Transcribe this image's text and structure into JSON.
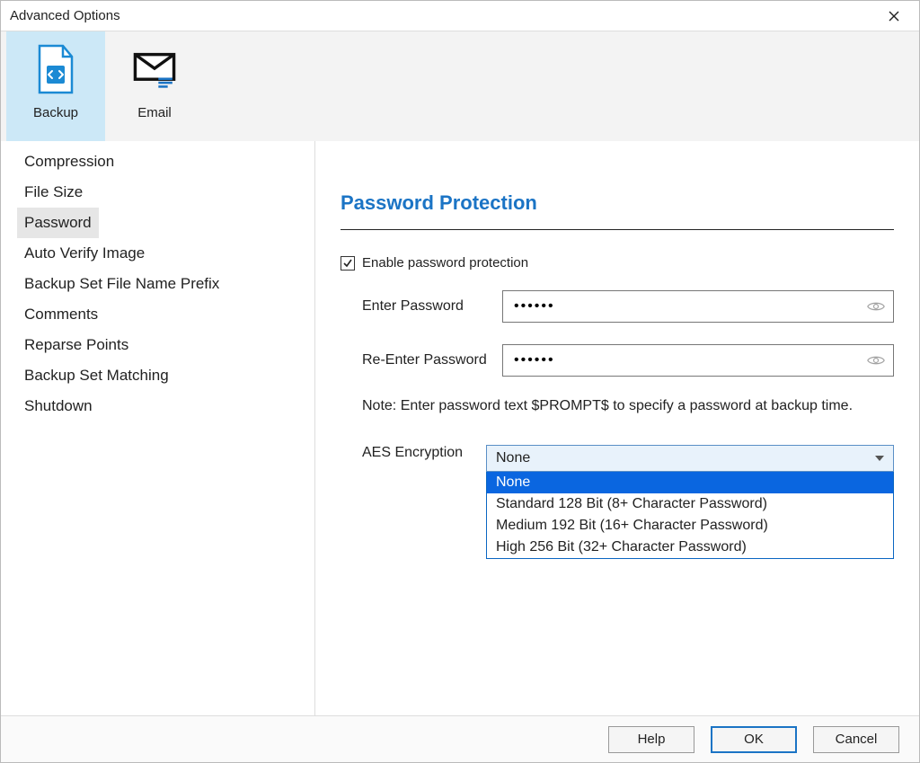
{
  "window": {
    "title": "Advanced Options"
  },
  "ribbon": {
    "backup_label": "Backup",
    "email_label": "Email"
  },
  "sidebar": {
    "items": [
      "Compression",
      "File Size",
      "Password",
      "Auto Verify Image",
      "Backup Set File Name Prefix",
      "Comments",
      "Reparse Points",
      "Backup Set Matching",
      "Shutdown"
    ],
    "selected_index": 2
  },
  "panel": {
    "heading": "Password Protection",
    "enable_label": "Enable password protection",
    "enable_checked": true,
    "enter_password_label": "Enter Password",
    "reenter_password_label": "Re-Enter Password",
    "password_value": "••••••",
    "repassword_value": "••••••",
    "note": "Note: Enter password text $PROMPT$ to specify a password at backup time.",
    "aes_label": "AES Encryption",
    "aes_selected": "None",
    "aes_options": [
      "None",
      "Standard 128 Bit (8+ Character Password)",
      "Medium 192 Bit (16+ Character Password)",
      "High 256 Bit (32+ Character Password)"
    ],
    "aes_highlight_index": 0
  },
  "buttons": {
    "help": "Help",
    "ok": "OK",
    "cancel": "Cancel"
  }
}
